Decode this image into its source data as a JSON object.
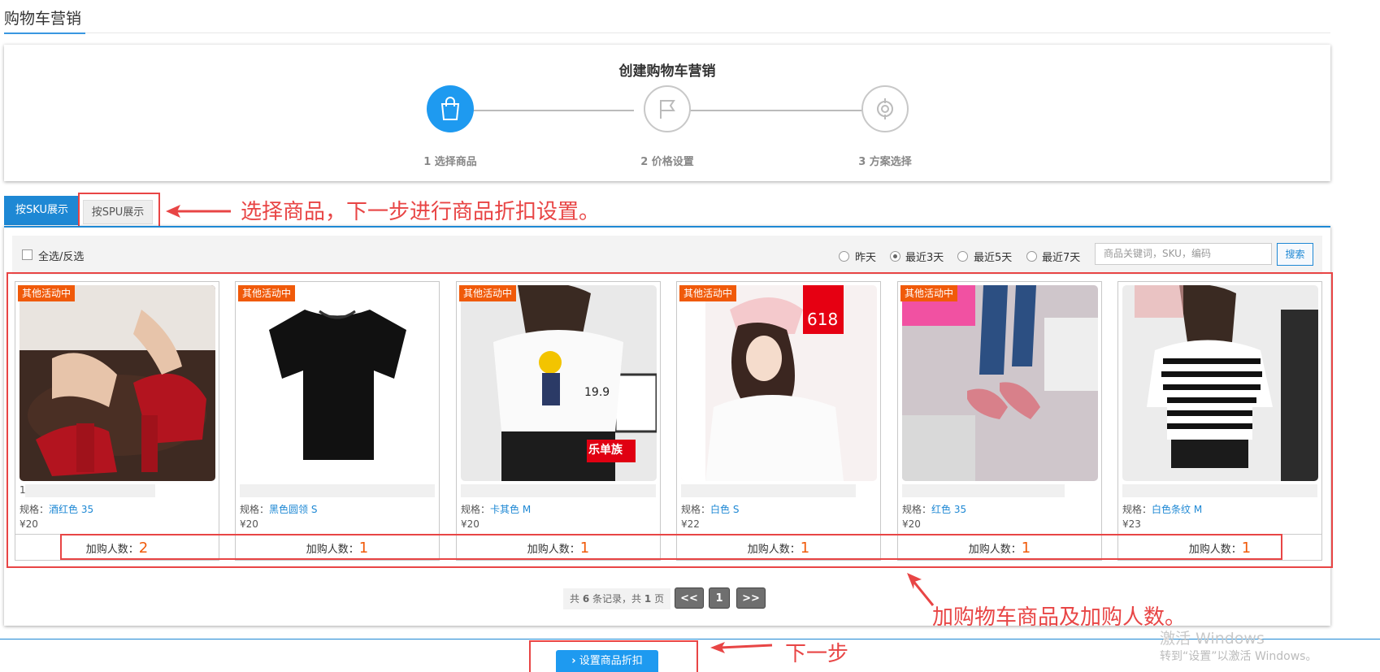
{
  "page": {
    "title": "购物车营销"
  },
  "steps": {
    "title": "创建购物车营销",
    "items": [
      {
        "label": "1 选择商品",
        "icon": "shopping-bag-icon",
        "state": "active"
      },
      {
        "label": "2 价格设置",
        "icon": "flag-icon",
        "state": "inactive"
      },
      {
        "label": "3 方案选择",
        "icon": "refresh-icon",
        "state": "inactive"
      }
    ]
  },
  "tabs": {
    "sku": "按SKU展示",
    "spu": "按SPU展示",
    "active": "sku"
  },
  "filter": {
    "select_all": "全选/反选",
    "ranges": [
      "昨天",
      "最近3天",
      "最近5天",
      "最近7天"
    ],
    "selected_range": "最近3天",
    "search_placeholder": "商品关键词，SKU，编码",
    "search_button": "搜索"
  },
  "products": [
    {
      "badge": "其他活动中",
      "spec_label": "规格：",
      "spec": "酒红色 35",
      "price": "¥20",
      "add_label": "加购人数：",
      "add_count": "2",
      "title_prefix": "1",
      "image": "red-sandal"
    },
    {
      "badge": "其他活动中",
      "spec_label": "规格：",
      "spec": "黑色圆领 S",
      "price": "¥20",
      "add_label": "加购人数：",
      "add_count": "1",
      "title_prefix": "",
      "image": "black-tshirt"
    },
    {
      "badge": "其他活动中",
      "spec_label": "规格：",
      "spec": "卡其色 M",
      "price": "¥20",
      "add_label": "加购人数：",
      "add_count": "1",
      "title_prefix": "",
      "image": "white-tshirt-girl",
      "img_text_1": "19.9",
      "img_text_2": "乐单族"
    },
    {
      "badge": "其他活动中",
      "spec_label": "规格：",
      "spec": "白色 S",
      "price": "¥22",
      "add_label": "加购人数：",
      "add_count": "1",
      "title_prefix": "",
      "image": "pink-tshirt-girl",
      "img_text_1": "618"
    },
    {
      "badge": "其他活动中",
      "spec_label": "规格：",
      "spec": "红色 35",
      "price": "¥20",
      "add_label": "加购人数：",
      "add_count": "1",
      "title_prefix": "",
      "image": "checked-flats"
    },
    {
      "badge": "",
      "spec_label": "规格：",
      "spec": "白色条纹 M",
      "price": "¥23",
      "add_label": "加购人数：",
      "add_count": "1",
      "title_prefix": "",
      "image": "striped-tshirt"
    }
  ],
  "pagination": {
    "info_prefix": "共",
    "records": "6",
    "info_mid": "条记录，共",
    "pages": "1",
    "info_suffix": "页",
    "prev": "<<",
    "current": "1",
    "next": ">>"
  },
  "actions": {
    "next_step": "设置商品折扣"
  },
  "annotations": {
    "tabs_note": "选择商品，下一步进行商品折扣设置。",
    "grid_note": "加购物车商品及加购人数。",
    "next_note": "下一步"
  },
  "watermark": {
    "line1": "激活 Windows",
    "line2": "转到“设置”以激活 Windows。"
  },
  "colors": {
    "accent": "#1e88d4",
    "annotation": "#e84545",
    "badge": "#f05a0a"
  }
}
